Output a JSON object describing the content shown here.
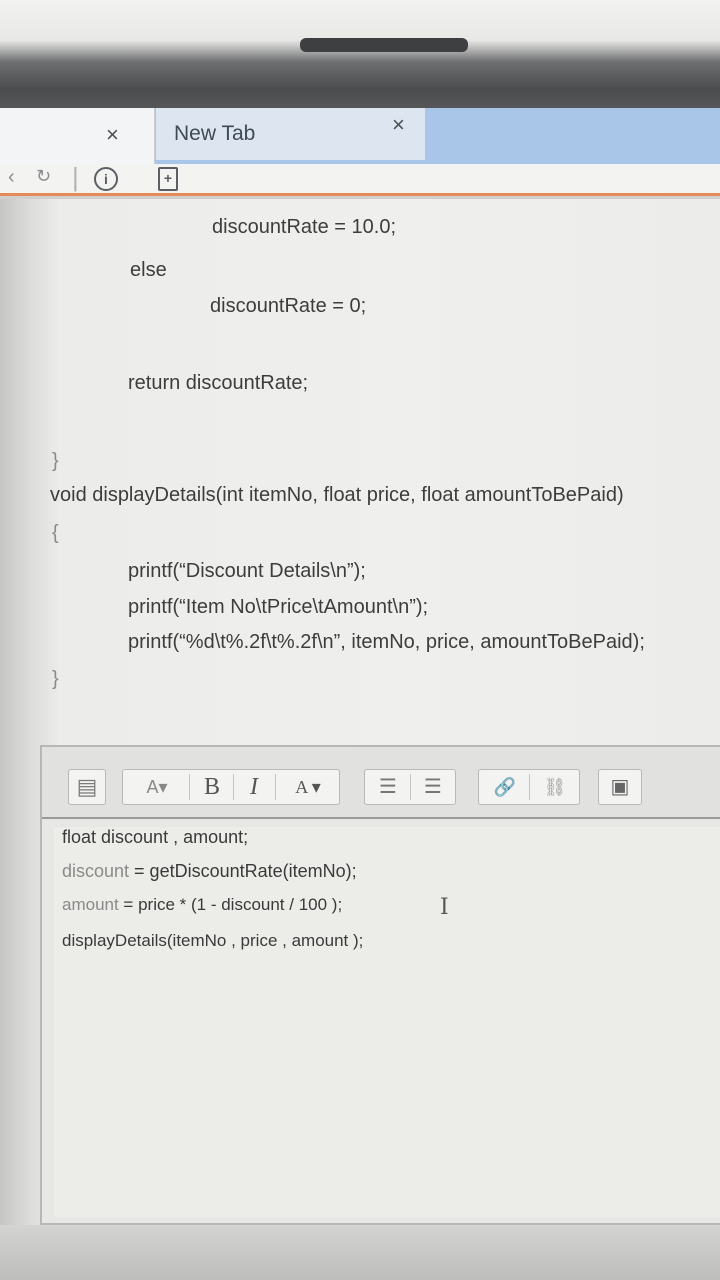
{
  "browser": {
    "tabs": [
      {
        "label": "",
        "close": "×"
      },
      {
        "label": "New Tab",
        "close": "×"
      }
    ],
    "toolbar": {
      "back_glyph": "‹",
      "reload_glyph": "↻",
      "info_glyph": "i",
      "page_glyph": "+"
    }
  },
  "code_lines": [
    "discountRate = 10.0;",
    "else",
    "discountRate  = 0;",
    "return discountRate;",
    "}",
    "void displayDetails(int itemNo, float price, float amountToBePaid)",
    "{",
    "printf(“Discount Details\\n”);",
    "printf(“Item No\\tPrice\\tAmount\\n”);",
    "printf(“%d\\t%.2f\\t%.2f\\n”, itemNo, price, amountToBePaid);",
    "}"
  ],
  "editor": {
    "toolbar": {
      "format_icon": "▤",
      "font_size_label": "A▾",
      "bold_label": "B",
      "italic_label": "I",
      "font_color_label": "A ▾",
      "bullet_list_icon": "☰",
      "numbered_list_icon": "☰",
      "link_icon": "🔗",
      "unlink_icon": "⛓",
      "image_icon": "▣"
    },
    "lines": [
      {
        "lhs": "",
        "rest": "float discount , amount;"
      },
      {
        "lhs": "discount",
        "rest": " = getDiscountRate(itemNo);"
      },
      {
        "lhs": "amount",
        "rest": " = price * (1 - discount / 100 );"
      },
      {
        "lhs": "",
        "rest": "displayDetails(itemNo , price , amount );"
      }
    ],
    "cursor_glyph": "I"
  },
  "colors": {
    "tab_bar": "#a9c6e8",
    "toolbar_accent": "#e78a5a",
    "page_bg": "#efefed"
  }
}
